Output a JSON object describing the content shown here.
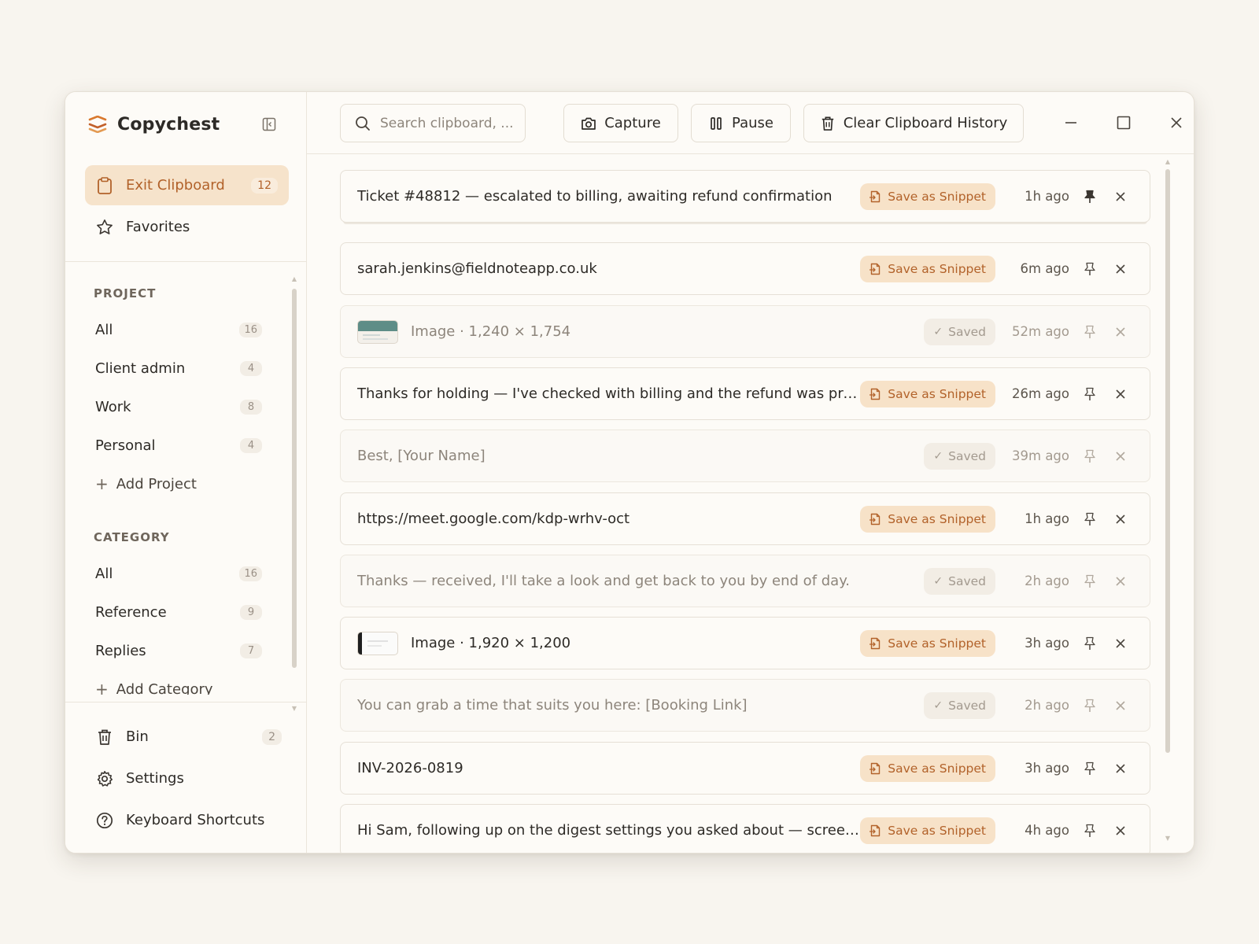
{
  "app": {
    "name": "Copychest"
  },
  "sidebar": {
    "top_nav": [
      {
        "label": "Exit Clipboard",
        "badge": "12",
        "icon": "clipboard-icon",
        "active": true
      },
      {
        "label": "Favorites",
        "icon": "star-icon",
        "active": false
      }
    ],
    "project": {
      "title": "PROJECT",
      "items": [
        {
          "label": "All",
          "count": "16"
        },
        {
          "label": "Client admin",
          "count": "4"
        },
        {
          "label": "Work",
          "count": "8"
        },
        {
          "label": "Personal",
          "count": "4"
        }
      ],
      "add_label": "Add Project"
    },
    "category": {
      "title": "CATEGORY",
      "items": [
        {
          "label": "All",
          "count": "16"
        },
        {
          "label": "Reference",
          "count": "9"
        },
        {
          "label": "Replies",
          "count": "7"
        }
      ],
      "add_label": "Add Category"
    },
    "bottom_nav": [
      {
        "label": "Bin",
        "badge": "2",
        "icon": "trash-icon"
      },
      {
        "label": "Settings",
        "icon": "gear-icon"
      },
      {
        "label": "Keyboard Shortcuts",
        "icon": "help-icon"
      }
    ]
  },
  "toolbar": {
    "search_placeholder": "Search clipboard, ...",
    "capture_label": "Capture",
    "pause_label": "Pause",
    "clear_label": "Clear Clipboard History"
  },
  "colors": {
    "accent": "#b2622a",
    "accent_bg": "#f7e2c8",
    "page_bg": "#f8f5ef",
    "window_bg": "#fdfbf7"
  },
  "clips": [
    {
      "text": "Ticket #48812 — escalated to billing, awaiting refund confirmation",
      "type": "text",
      "status": "snippet",
      "time": "1h ago",
      "pinned": true
    },
    {
      "text": "sarah.jenkins@fieldnoteapp.co.uk",
      "type": "text",
      "status": "snippet",
      "time": "6m ago",
      "pinned": false
    },
    {
      "text": "Image · 1,240 × 1,754",
      "type": "image",
      "status": "saved",
      "time": "52m ago",
      "pinned": false
    },
    {
      "text": "Thanks for holding — I've checked with billing and the refund was process...",
      "type": "text",
      "status": "snippet",
      "time": "26m ago",
      "pinned": false
    },
    {
      "text": "Best, [Your Name]",
      "type": "text",
      "status": "saved",
      "time": "39m ago",
      "pinned": false
    },
    {
      "text": "https://meet.google.com/kdp-wrhv-oct",
      "type": "text",
      "status": "snippet",
      "time": "1h ago",
      "pinned": false
    },
    {
      "text": "Thanks — received, I'll take a look and get back to you by end of day.",
      "type": "text",
      "status": "saved",
      "time": "2h ago",
      "pinned": false
    },
    {
      "text": "Image · 1,920 × 1,200",
      "type": "image",
      "status": "snippet",
      "time": "3h ago",
      "pinned": false
    },
    {
      "text": "You can grab a time that suits you here: [Booking Link]",
      "type": "text",
      "status": "saved",
      "time": "2h ago",
      "pinned": false
    },
    {
      "text": "INV-2026-0819",
      "type": "text",
      "status": "snippet",
      "time": "3h ago",
      "pinned": false
    },
    {
      "text": "Hi Sam, following up on the digest settings you asked about — screensho...",
      "type": "text",
      "status": "snippet",
      "time": "4h ago",
      "pinned": false
    }
  ],
  "labels": {
    "save_snippet": "Save as Snippet",
    "saved": "Saved"
  }
}
